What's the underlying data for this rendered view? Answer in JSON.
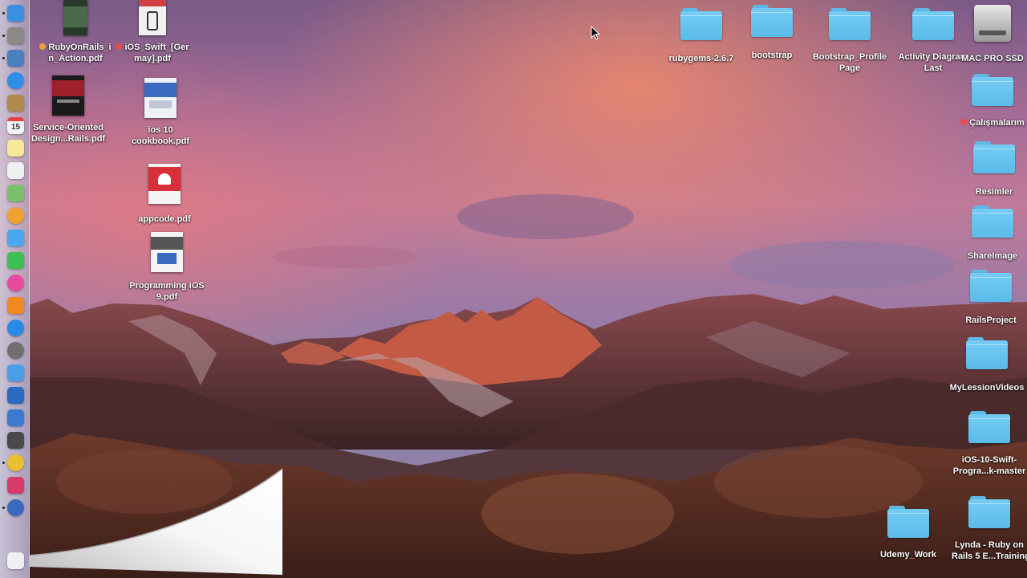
{
  "desktop_left": [
    {
      "name": "RubyOnRails_i\nn_Action.pdf",
      "tag": "#e8a23a"
    },
    {
      "name": "iOS_Swift_[Ger\nmay].pdf",
      "tag": "#e84b4b"
    },
    {
      "name": "Service-Oriented\nDesign...Rails.pdf",
      "tag": ""
    },
    {
      "name": "ios 10\ncookbook.pdf",
      "tag": ""
    },
    {
      "name": "appcode.pdf",
      "tag": ""
    },
    {
      "name": "Programming iOS\n9.pdf",
      "tag": ""
    }
  ],
  "desktop_top": [
    {
      "name": "rubygems-2.6.7"
    },
    {
      "name": "bootstrap"
    },
    {
      "name": "Bootstrap_Profile\nPage"
    },
    {
      "name": "Activity Diagram\nLast"
    },
    {
      "name": "MAC PRO SSD"
    }
  ],
  "desktop_right": [
    {
      "name": "Çalışmalarım",
      "tag": "#e84b4b"
    },
    {
      "name": "Resimler",
      "tag": ""
    },
    {
      "name": "ShareImage",
      "tag": ""
    },
    {
      "name": "RailsProject",
      "tag": ""
    },
    {
      "name": "MyLessionVideos",
      "tag": ""
    },
    {
      "name": "iOS-10-Swift-\nProgra...k-master",
      "tag": ""
    },
    {
      "name": "Udemy_Work",
      "tag": ""
    },
    {
      "name": "Lynda - Ruby on\nRails 5 E...Training",
      "tag": ""
    }
  ],
  "dock": [
    {
      "icon": "finder-icon",
      "color": "#3a8fe0"
    },
    {
      "icon": "launchpad-icon",
      "color": "#8a8a8a"
    },
    {
      "icon": "preview-icon",
      "color": "#4a7fc0"
    },
    {
      "icon": "safari-icon",
      "color": "#2f8fe8"
    },
    {
      "icon": "contacts-icon",
      "color": "#b08a4a"
    },
    {
      "icon": "calendar-icon",
      "color": "#f4f4f4",
      "label": "15"
    },
    {
      "icon": "notes-icon",
      "color": "#f6e99a"
    },
    {
      "icon": "reminders-icon",
      "color": "#f0f0f0"
    },
    {
      "icon": "maps-icon",
      "color": "#7cc06a"
    },
    {
      "icon": "photos-icon",
      "color": "#f0a030"
    },
    {
      "icon": "messages-icon",
      "color": "#4aa8f0"
    },
    {
      "icon": "facetime-icon",
      "color": "#3cc050"
    },
    {
      "icon": "itunes-icon",
      "color": "#e84aa0"
    },
    {
      "icon": "ibooks-icon",
      "color": "#f08a20"
    },
    {
      "icon": "app-store-icon",
      "color": "#2a8ae8"
    },
    {
      "icon": "system-preferences-icon",
      "color": "#707070"
    },
    {
      "icon": "twitter-icon",
      "color": "#4aa0e8"
    },
    {
      "icon": "xcode-icon",
      "color": "#2a6ac0"
    },
    {
      "icon": "simulator-icon",
      "color": "#3a7ad0"
    },
    {
      "icon": "sublime-text-icon",
      "color": "#4a4a4a"
    },
    {
      "icon": "chrome-icon",
      "color": "#e8c030"
    },
    {
      "icon": "rubymine-icon",
      "color": "#d83a6a"
    },
    {
      "icon": "quicktime-icon",
      "color": "#3a6ac0"
    },
    {
      "icon": "finder-window-icon",
      "color": "#f0f0f0"
    }
  ],
  "colors": {
    "folder": "#6cc6f2",
    "accent_red": "#e84b4b",
    "accent_orange": "#e8a23a"
  }
}
